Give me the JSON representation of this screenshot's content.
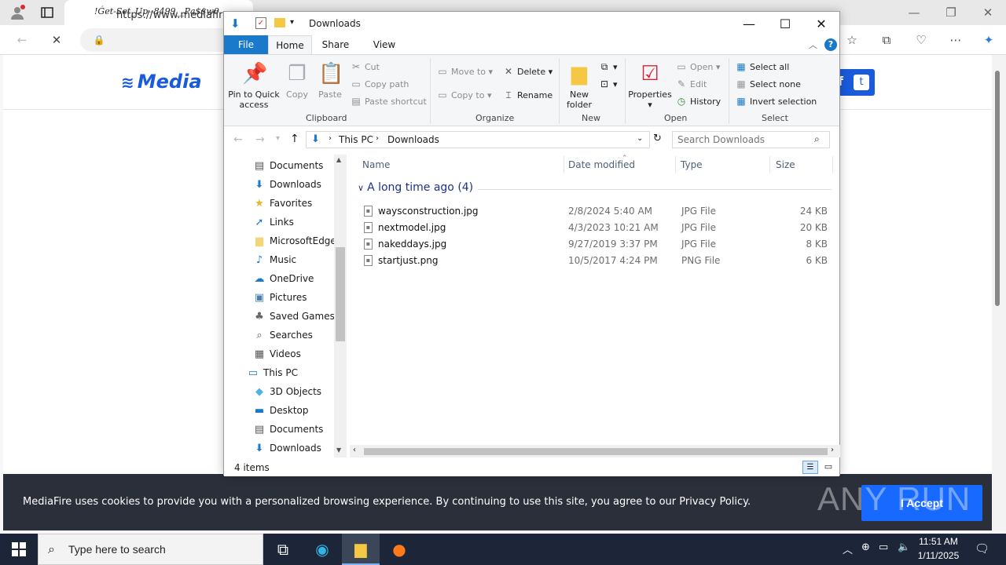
{
  "browser": {
    "tab_title": "!Ǵet-𝑆𝑒𝑡_𝑈𝑝--8499__𝑃𝑎$$𝑤0",
    "url": "https://www.mediafire",
    "accent": "#1769ff"
  },
  "mediafire": {
    "logo_text": "Media",
    "cookie_text": "MediaFire uses cookies to provide you with a personalized browsing experience. By continuing to use this site, you agree to our Privacy Policy.",
    "accept_label": "I Accept",
    "watermark": "ANY RUN"
  },
  "explorer": {
    "title": "Downloads",
    "tabs": [
      "File",
      "Home",
      "Share",
      "View"
    ],
    "ribbon": {
      "clipboard": {
        "label": "Clipboard",
        "pin": "Pin to Quick access",
        "copy": "Copy",
        "paste": "Paste",
        "cut": "Cut",
        "copy_path": "Copy path",
        "paste_shortcut": "Paste shortcut"
      },
      "organize": {
        "label": "Organize",
        "move_to": "Move to",
        "copy_to": "Copy to",
        "delete": "Delete",
        "rename": "Rename"
      },
      "new": {
        "label": "New",
        "new_folder": "New folder"
      },
      "open": {
        "label": "Open",
        "properties": "Properties",
        "open": "Open",
        "edit": "Edit",
        "history": "History"
      },
      "select": {
        "label": "Select",
        "select_all": "Select all",
        "select_none": "Select none",
        "invert": "Invert selection"
      }
    },
    "breadcrumb": [
      "This PC",
      "Downloads"
    ],
    "search_placeholder": "Search Downloads",
    "nav_items": [
      {
        "label": "Documents",
        "icon": "document-icon"
      },
      {
        "label": "Downloads",
        "icon": "download-icon"
      },
      {
        "label": "Favorites",
        "icon": "star-icon"
      },
      {
        "label": "Links",
        "icon": "link-icon"
      },
      {
        "label": "MicrosoftEdge",
        "icon": "folder-icon"
      },
      {
        "label": "Music",
        "icon": "music-icon"
      },
      {
        "label": "OneDrive",
        "icon": "cloud-icon"
      },
      {
        "label": "Pictures",
        "icon": "picture-icon"
      },
      {
        "label": "Saved Games",
        "icon": "game-icon"
      },
      {
        "label": "Searches",
        "icon": "search-icon"
      },
      {
        "label": "Videos",
        "icon": "video-icon"
      },
      {
        "label": "This PC",
        "icon": "computer-icon"
      },
      {
        "label": "3D Objects",
        "icon": "cube-icon"
      },
      {
        "label": "Desktop",
        "icon": "desktop-icon"
      },
      {
        "label": "Documents",
        "icon": "document-icon"
      },
      {
        "label": "Downloads",
        "icon": "download-icon"
      }
    ],
    "columns": [
      "Name",
      "Date modified",
      "Type",
      "Size"
    ],
    "group_header": "A long time ago (4)",
    "files": [
      {
        "name": "waysconstruction.jpg",
        "date": "2/8/2024 5:40 AM",
        "type": "JPG File",
        "size": "24 KB"
      },
      {
        "name": "nextmodel.jpg",
        "date": "4/3/2023 10:21 AM",
        "type": "JPG File",
        "size": "20 KB"
      },
      {
        "name": "nakeddays.jpg",
        "date": "9/27/2019 3:37 PM",
        "type": "JPG File",
        "size": "8 KB"
      },
      {
        "name": "startjust.png",
        "date": "10/5/2017 4:24 PM",
        "type": "PNG File",
        "size": "6 KB"
      }
    ],
    "status": "4 items"
  },
  "taskbar": {
    "search_placeholder": "Type here to search",
    "time": "11:51 AM",
    "date": "1/11/2025"
  }
}
